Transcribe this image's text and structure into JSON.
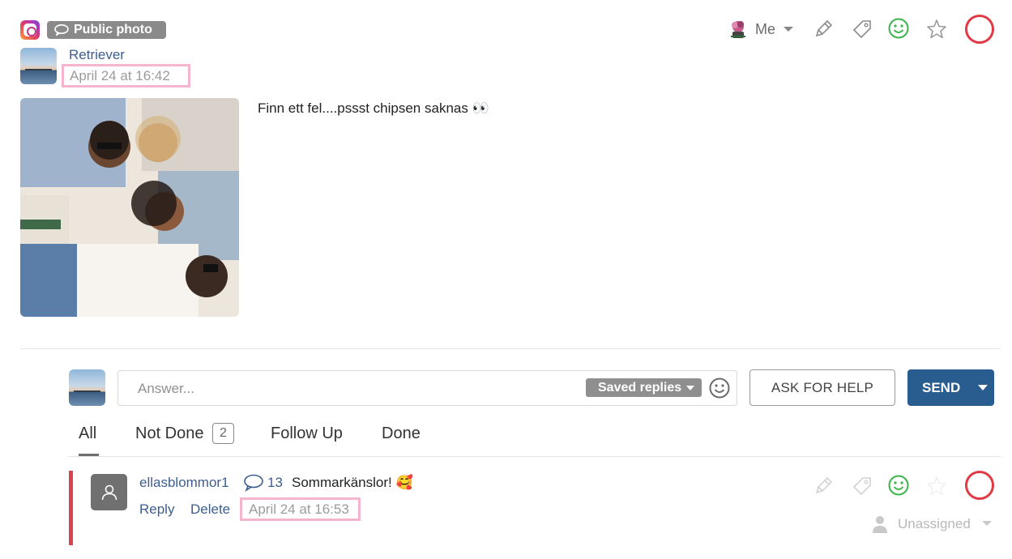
{
  "header": {
    "network_icon": "instagram-icon",
    "badge_label": "Public photo",
    "assignee_label": "Me"
  },
  "post": {
    "author": "Retriever",
    "timestamp": "April 24 at 16:42",
    "text": "Finn ett fel....pssst chipsen saknas 👀"
  },
  "reply": {
    "placeholder": "Answer...",
    "saved_replies_label": "Saved replies",
    "ask_for_help_label": "ASK FOR HELP",
    "send_label": "SEND"
  },
  "tabs": [
    {
      "label": "All",
      "active": true
    },
    {
      "label": "Not Done",
      "count": "2"
    },
    {
      "label": "Follow Up"
    },
    {
      "label": "Done"
    }
  ],
  "comment": {
    "username": "ellasblommor1",
    "comment_count": "13",
    "text": "Sommarkänslor! 🥰",
    "reply_label": "Reply",
    "delete_label": "Delete",
    "timestamp": "April 24 at 16:53",
    "assignee_label": "Unassigned"
  },
  "colors": {
    "accent_blue": "#2a5d8f",
    "link_blue": "#3e5e8e",
    "status_red": "#e03a44",
    "smiley_green": "#3bb54a",
    "highlight_pink": "#f6b5cf"
  }
}
